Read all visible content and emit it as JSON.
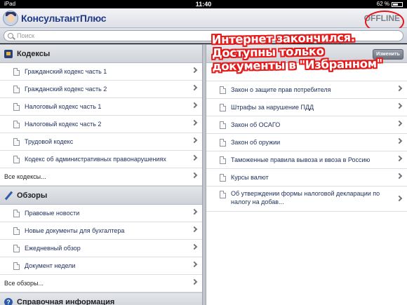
{
  "status": {
    "device": "iPad",
    "time": "11:40",
    "battery": "62 %",
    "battery_level": 0.62
  },
  "header": {
    "brand": "КонсультантПлюс",
    "offline": "OFFLINE"
  },
  "search": {
    "placeholder": "Поиск"
  },
  "annotation": {
    "lines": [
      "Интернет закончился.",
      "Доступны только",
      "документы в \"Избранном\""
    ]
  },
  "sections": {
    "codes": {
      "title": "Кодексы",
      "items": [
        "Гражданский кодекс часть 1",
        "Гражданский кодекс часть 2",
        "Налоговый кодекс часть 1",
        "Налоговый кодекс часть 2",
        "Трудовой кодекс",
        "Кодекс об административных правонарушениях"
      ],
      "all": "Все кодексы..."
    },
    "reviews": {
      "title": "Обзоры",
      "items": [
        "Правовые новости",
        "Новые документы для бухгалтера",
        "Ежедневный обзор",
        "Документ недели"
      ],
      "all": "Все обзоры..."
    },
    "reference": {
      "title": "Справочная информация"
    }
  },
  "favorites": {
    "edit_label": "Изменить",
    "items": [
      "Закон о защите прав потребителя",
      "Штрафы за нарушение ПДД",
      "Закон об ОСАГО",
      "Закон об оружии",
      "Таможенные правила вывоза и ввоза в Россию",
      "Курсы валют",
      "Об утверждении формы налоговой декларации по налогу на добав..."
    ]
  },
  "icons": {
    "codes": "book-icon",
    "reviews": "pen-icon",
    "reference": "help-icon",
    "document": "document-icon",
    "chevron": "chevron-right-icon",
    "search": "search-icon"
  },
  "colors": {
    "offline_circle": "#e3141b",
    "annotation": "#e51a1a",
    "link_text": "#1d2f5c",
    "brand": "#203a8a"
  }
}
